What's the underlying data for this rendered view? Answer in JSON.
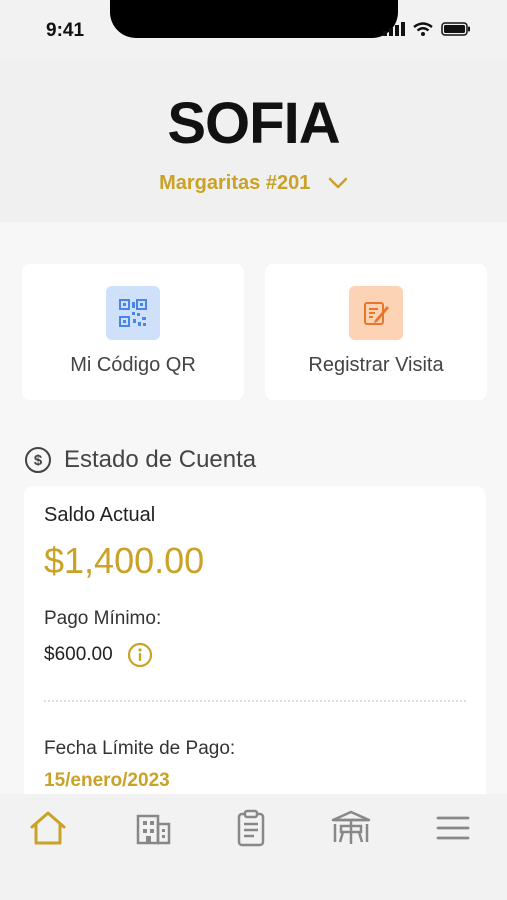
{
  "status_bar": {
    "time": "9:41"
  },
  "header": {
    "brand": "SOFIA",
    "unit_selector": "Margaritas #201"
  },
  "quick_actions": [
    {
      "label": "Mi Código QR",
      "icon": "qr-code-icon",
      "color": "#4a86e8"
    },
    {
      "label": "Registrar Visita",
      "icon": "edit-note-icon",
      "color": "#f08a3c"
    }
  ],
  "account": {
    "section_title": "Estado de Cuenta",
    "current_balance_label": "Saldo Actual",
    "current_balance": "$1,400.00",
    "minimum_payment_label": "Pago Mínimo:",
    "minimum_payment": "$600.00",
    "due_date_label": "Fecha Límite de Pago:",
    "due_date": "15/enero/2023"
  },
  "bottom_nav": [
    {
      "icon": "home-icon",
      "active": true
    },
    {
      "icon": "building-icon",
      "active": false
    },
    {
      "icon": "clipboard-icon",
      "active": false
    },
    {
      "icon": "amenities-icon",
      "active": false
    },
    {
      "icon": "menu-icon",
      "active": false
    }
  ],
  "colors": {
    "accent": "#c9a227",
    "qr_icon_bg": "#cfe0fb",
    "visit_icon_bg": "#fcd3b5"
  }
}
